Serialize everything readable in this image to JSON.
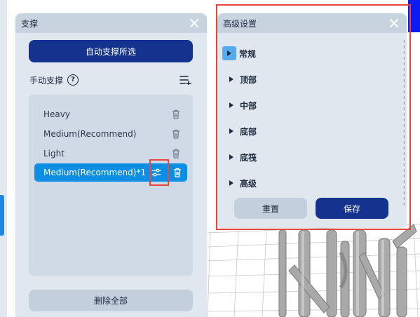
{
  "support_panel": {
    "title": "支撑",
    "auto_support_label": "自动支撑所选",
    "manual_support_label": "手动支撑",
    "help_glyph": "?",
    "presets": [
      {
        "label": "Heavy",
        "selected": false
      },
      {
        "label": "Medium(Recommend)",
        "selected": false
      },
      {
        "label": "Light",
        "selected": false
      },
      {
        "label": "Medium(Recommend)*1",
        "selected": true
      }
    ],
    "delete_all_label": "删除全部",
    "icons": {
      "close": "close-icon",
      "help": "help-icon",
      "add_list": "add-list-icon",
      "trash": "trash-icon",
      "settings": "sliders-icon"
    }
  },
  "advanced_panel": {
    "title": "高级设置",
    "sections": [
      {
        "label": "常规",
        "active": true
      },
      {
        "label": "顶部",
        "active": false
      },
      {
        "label": "中部",
        "active": false
      },
      {
        "label": "底部",
        "active": false
      },
      {
        "label": "底筏",
        "active": false
      },
      {
        "label": "高级",
        "active": false
      }
    ],
    "reset_label": "重置",
    "save_label": "保存"
  },
  "colors": {
    "primary": "#13338f",
    "selected": "#0b8ee3",
    "annotation": "#e5453b",
    "panel": "#e1e7ef",
    "panel_header": "#c8d3e0"
  }
}
